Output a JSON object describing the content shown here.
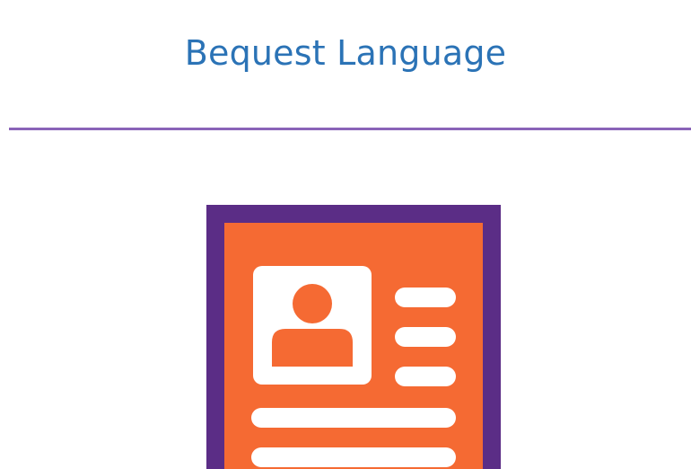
{
  "page": {
    "title": "Bequest Language"
  },
  "icons": {
    "document_icon": "profile-document-icon"
  },
  "colors": {
    "title": "#2b73b6",
    "divider": "#8a63b8",
    "icon_frame": "#5b2d86",
    "icon_fill": "#f56a33",
    "icon_detail": "#ffffff"
  }
}
